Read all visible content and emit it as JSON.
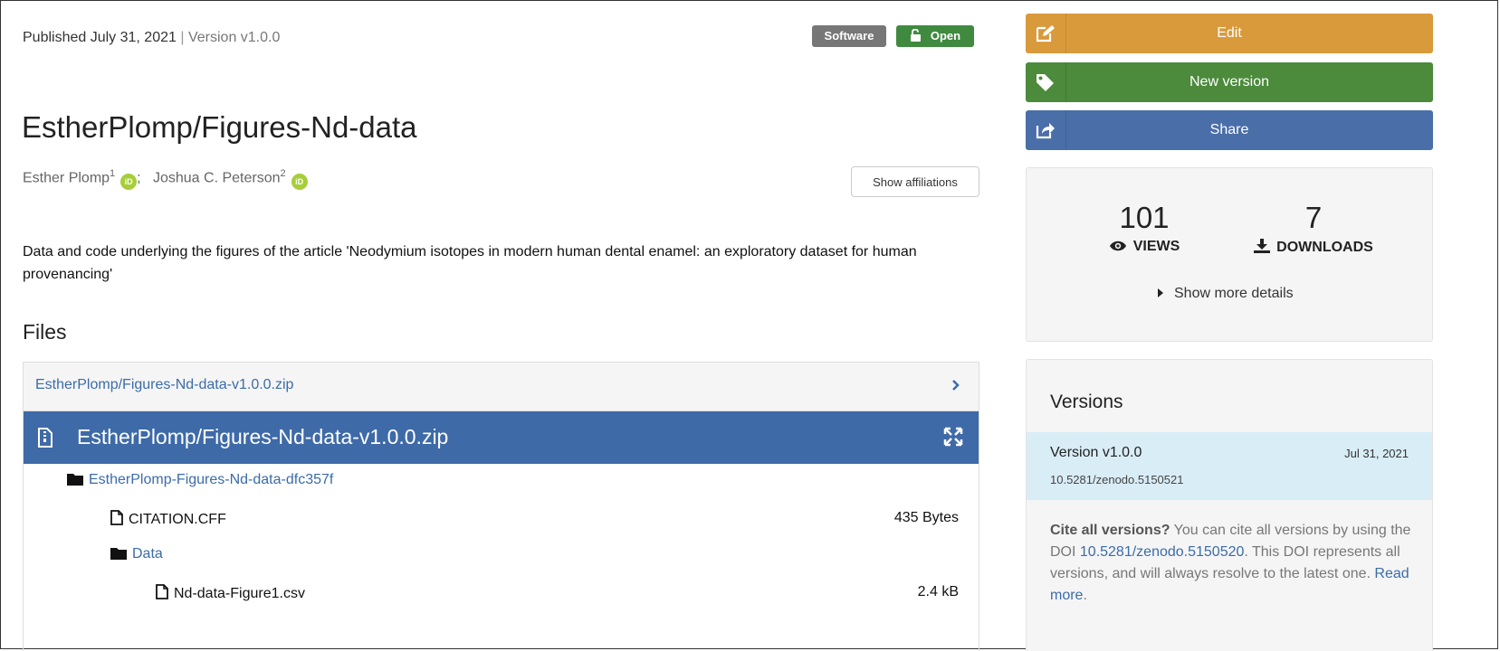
{
  "record": {
    "published": "Published July 31, 2021",
    "separator": "|",
    "version": "Version v1.0.0",
    "badges": {
      "type": "Software",
      "access": "Open"
    },
    "title": "EstherPlomp/Figures-Nd-data",
    "authors": [
      {
        "name": "Esther Plomp",
        "affiliation_ref": "1"
      },
      {
        "name": "Joshua C. Peterson",
        "affiliation_ref": "2"
      }
    ],
    "author_separator": ";",
    "orcid_label": "iD",
    "show_affiliations_label": "Show affiliations",
    "description": "Data and code underlying the figures of the article 'Neodymium isotopes in modern human dental enamel: an exploratory dataset for human provenancing'"
  },
  "files": {
    "heading": "Files",
    "zip_link": "EstherPlomp/Figures-Nd-data-v1.0.0.zip",
    "preview_title": "EstherPlomp/Figures-Nd-data-v1.0.0.zip",
    "tree": [
      {
        "name": "EstherPlomp-Figures-Nd-data-dfc357f",
        "kind": "folder",
        "size": ""
      },
      {
        "name": "CITATION.CFF",
        "kind": "file",
        "size": "435 Bytes"
      },
      {
        "name": "Data",
        "kind": "folder",
        "size": ""
      },
      {
        "name": "Nd-data-Figure1.csv",
        "kind": "file",
        "size": "2.4 kB"
      }
    ]
  },
  "sidebar": {
    "edit_label": "Edit",
    "new_version_label": "New version",
    "share_label": "Share",
    "colors": {
      "edit": "#d99a3c",
      "new_version": "#4c8a3c",
      "share": "#4a6ea8"
    },
    "stats": {
      "views_count": "101",
      "views_label": "VIEWS",
      "downloads_count": "7",
      "downloads_label": "DOWNLOADS",
      "more_details_label": "Show more details"
    },
    "versions": {
      "title": "Versions",
      "current": {
        "name": "Version v1.0.0",
        "date": "Jul 31, 2021",
        "doi": "10.5281/zenodo.5150521"
      },
      "cite_bold": "Cite all versions?",
      "cite_text_1": " You can cite all versions by using the DOI ",
      "cite_doi": "10.5281/zenodo.5150520",
      "cite_text_2": ". This DOI represents all versions, and will always resolve to the latest one. ",
      "read_more": "Read more",
      "cite_end": "."
    }
  },
  "icons": {
    "lock_open": "unlock-icon",
    "edit": "edit-icon",
    "tag": "tag-icon",
    "share": "share-icon",
    "eye": "eye-icon",
    "download": "download-icon",
    "caret": "caret-right-icon",
    "chevron": "chevron-right-icon",
    "expand": "expand-icon",
    "folder": "folder-icon",
    "file": "file-icon",
    "zip_file": "file-zip-icon"
  }
}
